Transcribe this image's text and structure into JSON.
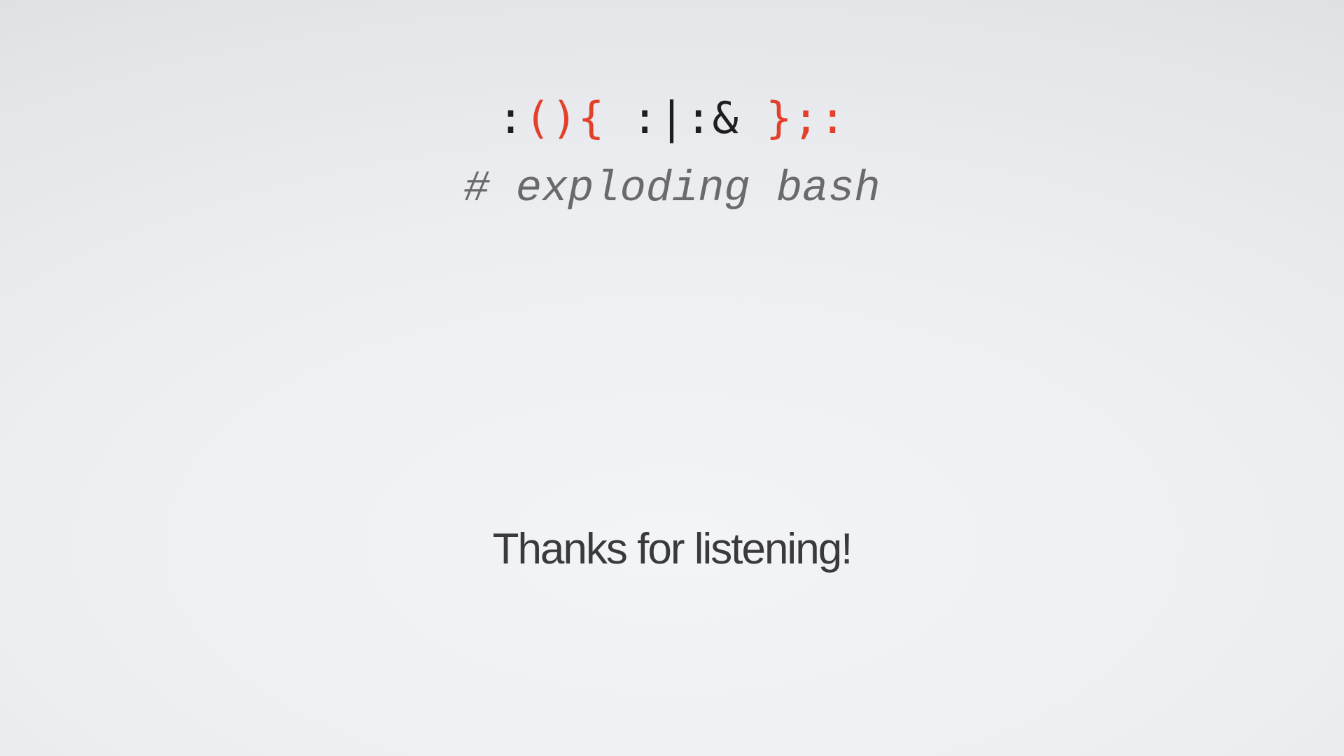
{
  "slide": {
    "code_tokens": [
      {
        "text": ":",
        "color": "#1e1e1e"
      },
      {
        "text": "(){",
        "color": "#e2402a"
      },
      {
        "text": " :|:& ",
        "color": "#1e1e1e"
      },
      {
        "text": "};:",
        "color": "#e2402a"
      }
    ],
    "comment": "# exploding bash",
    "thanks": "Thanks for listening!"
  }
}
